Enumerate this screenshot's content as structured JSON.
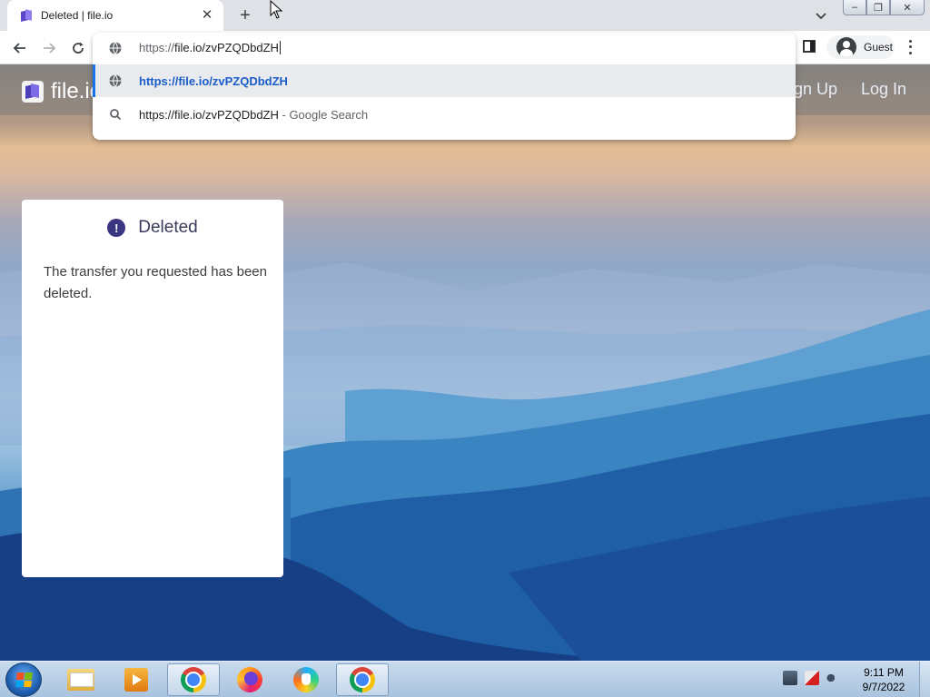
{
  "browser": {
    "tab": {
      "title": "Deleted | file.io",
      "close_glyph": "✕"
    },
    "new_tab_glyph": "+",
    "window_controls": {
      "minimize": "–",
      "maximize": "❐",
      "close": "✕"
    },
    "omnibox": {
      "value_prefix": "https://",
      "value_main": "file.io/zvPZQDbdZH",
      "suggestions": [
        {
          "icon": "globe-icon",
          "text": "https://file.io/zvPZQDbdZH",
          "suffix": ""
        },
        {
          "icon": "search-icon",
          "text": "https://file.io/zvPZQDbdZH",
          "suffix": " - Google Search"
        }
      ]
    },
    "profile": {
      "label": "Guest"
    }
  },
  "site": {
    "logo_text": "file.io",
    "nav": {
      "signup": "Sign Up",
      "login": "Log In"
    },
    "card": {
      "alert_glyph": "!",
      "title": "Deleted",
      "message": "The transfer you requested has been deleted."
    }
  },
  "taskbar": {
    "items": [
      {
        "name": "windows-explorer",
        "icon": "folder-icon"
      },
      {
        "name": "media-player",
        "icon": "media-player-icon"
      },
      {
        "name": "chrome",
        "icon": "chrome-icon",
        "active": true
      },
      {
        "name": "firefox",
        "icon": "firefox-icon"
      },
      {
        "name": "brave",
        "icon": "brave-icon"
      },
      {
        "name": "chrome",
        "icon": "chrome-icon",
        "active": true
      }
    ],
    "clock": {
      "time": "9:11 PM",
      "date": "9/7/2022"
    }
  },
  "colors": {
    "accent": "#1a73e8",
    "alert_icon": "#3a3680",
    "logo_primary": "#4b3fb8"
  }
}
